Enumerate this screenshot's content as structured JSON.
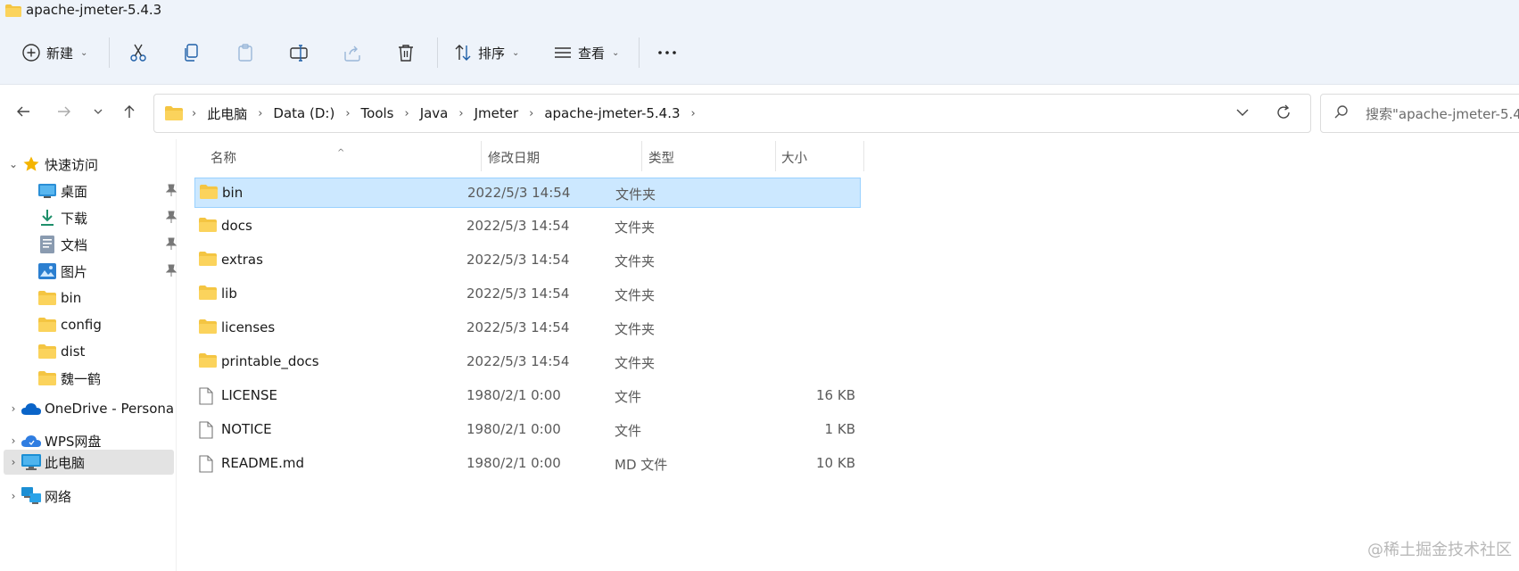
{
  "window": {
    "title": "apache-jmeter-5.4.3"
  },
  "toolbar": {
    "new_label": "新建",
    "sort_label": "排序",
    "view_label": "查看"
  },
  "address": {
    "crumbs": [
      "此电脑",
      "Data (D:)",
      "Tools",
      "Java",
      "Jmeter",
      "apache-jmeter-5.4.3"
    ],
    "search_placeholder": "搜索\"apache-jmeter-5.4"
  },
  "sidebar": {
    "quick_access": "快速访问",
    "items": [
      {
        "label": "桌面",
        "icon": "desktop-icon",
        "pinned": true
      },
      {
        "label": "下载",
        "icon": "download-icon",
        "pinned": true
      },
      {
        "label": "文档",
        "icon": "document-icon",
        "pinned": true
      },
      {
        "label": "图片",
        "icon": "pictures-icon",
        "pinned": true
      },
      {
        "label": "bin",
        "icon": "folder-icon",
        "pinned": false
      },
      {
        "label": "config",
        "icon": "folder-icon",
        "pinned": false
      },
      {
        "label": "dist",
        "icon": "folder-icon",
        "pinned": false
      },
      {
        "label": "魏一鹤",
        "icon": "folder-icon",
        "pinned": false
      }
    ],
    "onedrive": "OneDrive - Persona",
    "wps": "WPS网盘",
    "thispc": "此电脑",
    "network": "网络"
  },
  "columns": {
    "name": "名称",
    "date": "修改日期",
    "type": "类型",
    "size": "大小"
  },
  "files": [
    {
      "name": "bin",
      "date": "2022/5/3 14:54",
      "type": "文件夹",
      "size": "",
      "kind": "folder",
      "selected": true
    },
    {
      "name": "docs",
      "date": "2022/5/3 14:54",
      "type": "文件夹",
      "size": "",
      "kind": "folder"
    },
    {
      "name": "extras",
      "date": "2022/5/3 14:54",
      "type": "文件夹",
      "size": "",
      "kind": "folder"
    },
    {
      "name": "lib",
      "date": "2022/5/3 14:54",
      "type": "文件夹",
      "size": "",
      "kind": "folder"
    },
    {
      "name": "licenses",
      "date": "2022/5/3 14:54",
      "type": "文件夹",
      "size": "",
      "kind": "folder"
    },
    {
      "name": "printable_docs",
      "date": "2022/5/3 14:54",
      "type": "文件夹",
      "size": "",
      "kind": "folder"
    },
    {
      "name": "LICENSE",
      "date": "1980/2/1 0:00",
      "type": "文件",
      "size": "16 KB",
      "kind": "file"
    },
    {
      "name": "NOTICE",
      "date": "1980/2/1 0:00",
      "type": "文件",
      "size": "1 KB",
      "kind": "file"
    },
    {
      "name": "README.md",
      "date": "1980/2/1 0:00",
      "type": "MD 文件",
      "size": "10 KB",
      "kind": "file"
    }
  ],
  "watermark": "@稀土掘金技术社区",
  "colors": {
    "selection": "#cce8ff",
    "selection_border": "#99d1ff",
    "folder": "#f4c542",
    "chrome": "#eef3fa"
  }
}
